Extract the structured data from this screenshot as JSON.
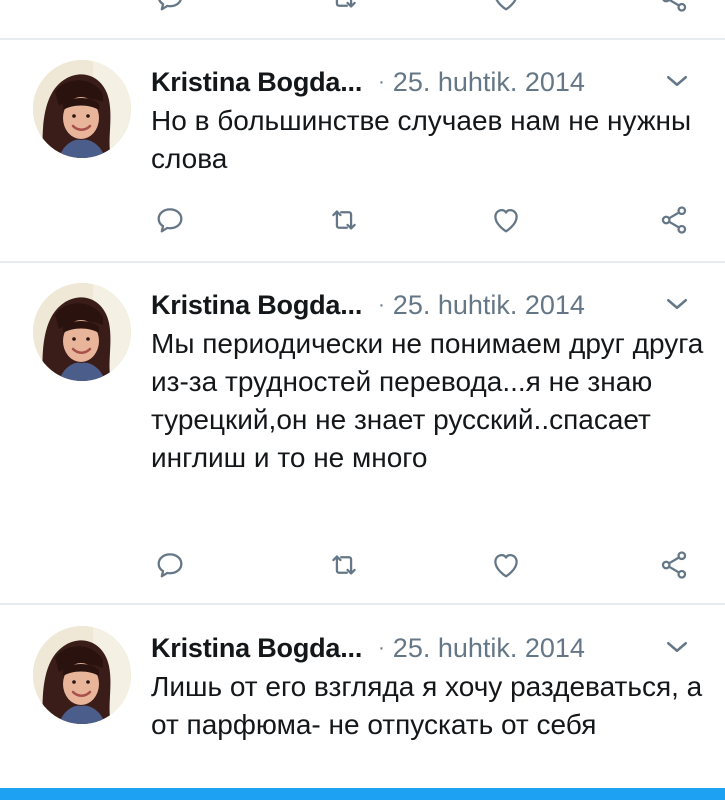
{
  "tweets": [
    {
      "author": "Kristina Bogda...",
      "separator": "·",
      "date": "25. huhtik. 2014",
      "text": "Но в большинстве случаев нам не нужны слова"
    },
    {
      "author": "Kristina Bogda...",
      "separator": "·",
      "date": "25. huhtik. 2014",
      "text": "Мы периодически не понимаем друг друга из-за трудностей перевода...я не знаю турецкий,он не знает русский..спасает инглиш и то не много"
    },
    {
      "author": "Kristina Bogda...",
      "separator": "·",
      "date": "25. huhtik. 2014",
      "text": "Лишь от его взгляда я хочу раздеваться, а от парфюма- не отпускать от себя"
    }
  ],
  "icons": {
    "reply": "reply-icon",
    "retweet": "retweet-icon",
    "like": "heart-icon",
    "share": "share-icon",
    "menu": "chevron-down-icon",
    "avatar": "avatar"
  },
  "colors": {
    "text": "#14171a",
    "secondary": "#657786",
    "divider": "#e6ecf0",
    "accent": "#1da1f2"
  }
}
